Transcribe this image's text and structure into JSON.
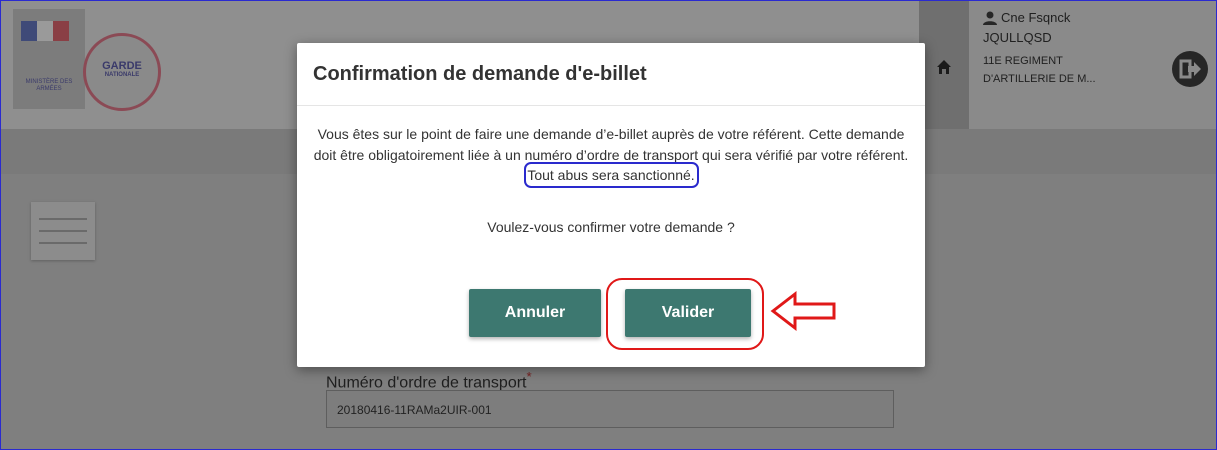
{
  "header": {
    "ministry_text": "MINISTÈRE DES ARMÉES",
    "logo_text": "GARDE",
    "logo_subtext": "NATIONALE"
  },
  "user": {
    "name": "Cne Fsqnck",
    "code": "JQULLQSD",
    "unit": "11E REGIMENT D'ARTILLERIE DE M..."
  },
  "form": {
    "field_label": "Numéro d'ordre de transport",
    "required_marker": "*",
    "field_value": "20180416-11RAMa2UIR-001"
  },
  "modal": {
    "title": "Confirmation de demande d'e-billet",
    "body_main": "Vous êtes sur le point de faire une demande d’e-billet auprès de votre référent. Cette demande doit être obligatoirement liée à un numéro d’ordre de transport qui sera vérifié par votre référent.",
    "body_warning": "Tout abus sera sanctionné.",
    "question": "Voulez-vous confirmer votre demande ?",
    "cancel_label": "Annuler",
    "confirm_label": "Valider"
  },
  "colors": {
    "button": "#3d7870",
    "annotation_red": "#e01818",
    "annotation_blue": "#2a2acd",
    "overlay_gray": "#8f8f8f"
  },
  "icons": [
    "home-icon",
    "user-icon",
    "logout-icon",
    "menu-icon"
  ]
}
